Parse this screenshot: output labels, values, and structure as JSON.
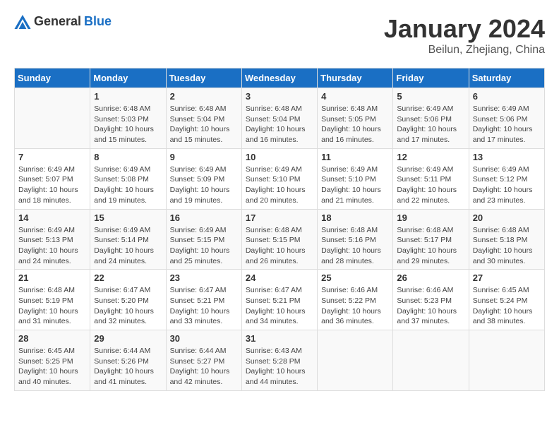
{
  "header": {
    "logo_general": "General",
    "logo_blue": "Blue",
    "month_title": "January 2024",
    "location": "Beilun, Zhejiang, China"
  },
  "weekdays": [
    "Sunday",
    "Monday",
    "Tuesday",
    "Wednesday",
    "Thursday",
    "Friday",
    "Saturday"
  ],
  "weeks": [
    [
      {
        "day": "",
        "sunrise": "",
        "sunset": "",
        "daylight": ""
      },
      {
        "day": "1",
        "sunrise": "Sunrise: 6:48 AM",
        "sunset": "Sunset: 5:03 PM",
        "daylight": "Daylight: 10 hours and 15 minutes."
      },
      {
        "day": "2",
        "sunrise": "Sunrise: 6:48 AM",
        "sunset": "Sunset: 5:04 PM",
        "daylight": "Daylight: 10 hours and 15 minutes."
      },
      {
        "day": "3",
        "sunrise": "Sunrise: 6:48 AM",
        "sunset": "Sunset: 5:04 PM",
        "daylight": "Daylight: 10 hours and 16 minutes."
      },
      {
        "day": "4",
        "sunrise": "Sunrise: 6:48 AM",
        "sunset": "Sunset: 5:05 PM",
        "daylight": "Daylight: 10 hours and 16 minutes."
      },
      {
        "day": "5",
        "sunrise": "Sunrise: 6:49 AM",
        "sunset": "Sunset: 5:06 PM",
        "daylight": "Daylight: 10 hours and 17 minutes."
      },
      {
        "day": "6",
        "sunrise": "Sunrise: 6:49 AM",
        "sunset": "Sunset: 5:06 PM",
        "daylight": "Daylight: 10 hours and 17 minutes."
      }
    ],
    [
      {
        "day": "7",
        "sunrise": "Sunrise: 6:49 AM",
        "sunset": "Sunset: 5:07 PM",
        "daylight": "Daylight: 10 hours and 18 minutes."
      },
      {
        "day": "8",
        "sunrise": "Sunrise: 6:49 AM",
        "sunset": "Sunset: 5:08 PM",
        "daylight": "Daylight: 10 hours and 19 minutes."
      },
      {
        "day": "9",
        "sunrise": "Sunrise: 6:49 AM",
        "sunset": "Sunset: 5:09 PM",
        "daylight": "Daylight: 10 hours and 19 minutes."
      },
      {
        "day": "10",
        "sunrise": "Sunrise: 6:49 AM",
        "sunset": "Sunset: 5:10 PM",
        "daylight": "Daylight: 10 hours and 20 minutes."
      },
      {
        "day": "11",
        "sunrise": "Sunrise: 6:49 AM",
        "sunset": "Sunset: 5:10 PM",
        "daylight": "Daylight: 10 hours and 21 minutes."
      },
      {
        "day": "12",
        "sunrise": "Sunrise: 6:49 AM",
        "sunset": "Sunset: 5:11 PM",
        "daylight": "Daylight: 10 hours and 22 minutes."
      },
      {
        "day": "13",
        "sunrise": "Sunrise: 6:49 AM",
        "sunset": "Sunset: 5:12 PM",
        "daylight": "Daylight: 10 hours and 23 minutes."
      }
    ],
    [
      {
        "day": "14",
        "sunrise": "Sunrise: 6:49 AM",
        "sunset": "Sunset: 5:13 PM",
        "daylight": "Daylight: 10 hours and 24 minutes."
      },
      {
        "day": "15",
        "sunrise": "Sunrise: 6:49 AM",
        "sunset": "Sunset: 5:14 PM",
        "daylight": "Daylight: 10 hours and 24 minutes."
      },
      {
        "day": "16",
        "sunrise": "Sunrise: 6:49 AM",
        "sunset": "Sunset: 5:15 PM",
        "daylight": "Daylight: 10 hours and 25 minutes."
      },
      {
        "day": "17",
        "sunrise": "Sunrise: 6:48 AM",
        "sunset": "Sunset: 5:15 PM",
        "daylight": "Daylight: 10 hours and 26 minutes."
      },
      {
        "day": "18",
        "sunrise": "Sunrise: 6:48 AM",
        "sunset": "Sunset: 5:16 PM",
        "daylight": "Daylight: 10 hours and 28 minutes."
      },
      {
        "day": "19",
        "sunrise": "Sunrise: 6:48 AM",
        "sunset": "Sunset: 5:17 PM",
        "daylight": "Daylight: 10 hours and 29 minutes."
      },
      {
        "day": "20",
        "sunrise": "Sunrise: 6:48 AM",
        "sunset": "Sunset: 5:18 PM",
        "daylight": "Daylight: 10 hours and 30 minutes."
      }
    ],
    [
      {
        "day": "21",
        "sunrise": "Sunrise: 6:48 AM",
        "sunset": "Sunset: 5:19 PM",
        "daylight": "Daylight: 10 hours and 31 minutes."
      },
      {
        "day": "22",
        "sunrise": "Sunrise: 6:47 AM",
        "sunset": "Sunset: 5:20 PM",
        "daylight": "Daylight: 10 hours and 32 minutes."
      },
      {
        "day": "23",
        "sunrise": "Sunrise: 6:47 AM",
        "sunset": "Sunset: 5:21 PM",
        "daylight": "Daylight: 10 hours and 33 minutes."
      },
      {
        "day": "24",
        "sunrise": "Sunrise: 6:47 AM",
        "sunset": "Sunset: 5:21 PM",
        "daylight": "Daylight: 10 hours and 34 minutes."
      },
      {
        "day": "25",
        "sunrise": "Sunrise: 6:46 AM",
        "sunset": "Sunset: 5:22 PM",
        "daylight": "Daylight: 10 hours and 36 minutes."
      },
      {
        "day": "26",
        "sunrise": "Sunrise: 6:46 AM",
        "sunset": "Sunset: 5:23 PM",
        "daylight": "Daylight: 10 hours and 37 minutes."
      },
      {
        "day": "27",
        "sunrise": "Sunrise: 6:45 AM",
        "sunset": "Sunset: 5:24 PM",
        "daylight": "Daylight: 10 hours and 38 minutes."
      }
    ],
    [
      {
        "day": "28",
        "sunrise": "Sunrise: 6:45 AM",
        "sunset": "Sunset: 5:25 PM",
        "daylight": "Daylight: 10 hours and 40 minutes."
      },
      {
        "day": "29",
        "sunrise": "Sunrise: 6:44 AM",
        "sunset": "Sunset: 5:26 PM",
        "daylight": "Daylight: 10 hours and 41 minutes."
      },
      {
        "day": "30",
        "sunrise": "Sunrise: 6:44 AM",
        "sunset": "Sunset: 5:27 PM",
        "daylight": "Daylight: 10 hours and 42 minutes."
      },
      {
        "day": "31",
        "sunrise": "Sunrise: 6:43 AM",
        "sunset": "Sunset: 5:28 PM",
        "daylight": "Daylight: 10 hours and 44 minutes."
      },
      {
        "day": "",
        "sunrise": "",
        "sunset": "",
        "daylight": ""
      },
      {
        "day": "",
        "sunrise": "",
        "sunset": "",
        "daylight": ""
      },
      {
        "day": "",
        "sunrise": "",
        "sunset": "",
        "daylight": ""
      }
    ]
  ]
}
